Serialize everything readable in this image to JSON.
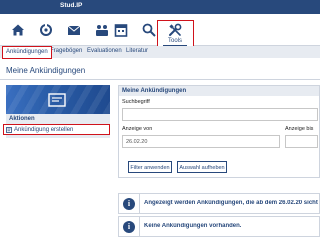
{
  "app": {
    "title": "Stud.IP"
  },
  "nav": {
    "items": [
      {
        "icon": "home-icon"
      },
      {
        "icon": "activity-icon"
      },
      {
        "icon": "messages-icon"
      },
      {
        "icon": "community-icon"
      },
      {
        "icon": "schedule-icon"
      },
      {
        "icon": "search-icon"
      }
    ],
    "tools": {
      "icon": "tools-icon",
      "label": "Tools"
    }
  },
  "subnav": {
    "tabs": [
      "Ankündigungen",
      "Fragebögen",
      "Evaluationen",
      "Literatur"
    ]
  },
  "page": {
    "title": "Meine Ankündigungen"
  },
  "sidebar": {
    "actions_title": "Aktionen",
    "create_label": "Ankündigung erstellen"
  },
  "filter": {
    "title": "Meine Ankündigungen",
    "search_label": "Suchbegriff",
    "search_value": "",
    "from_label": "Anzeige von",
    "from_value": "26.02.20",
    "until_label": "Anzeige bis",
    "until_value": "",
    "apply_button": "Filter anwenden",
    "reset_button": "Auswahl aufheben"
  },
  "messages": {
    "info1": "Angezeigt werden Ankündigungen, die ab dem 26.02.20 sichtbar",
    "info2": "Keine Ankündigungen vorhanden."
  },
  "colors": {
    "brand": "#28497c",
    "highlight": "#d0121b",
    "panel": "#e7ebf1"
  }
}
